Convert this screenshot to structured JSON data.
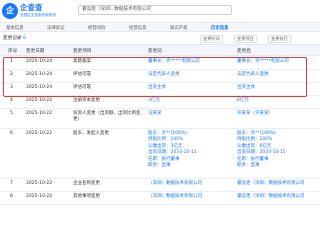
{
  "header": {
    "logo_mark": "企",
    "logo_name": "企查查",
    "logo_sub": "全国企业信用查询系统",
    "company_name": "睿竞炬（深圳）数据技术有限公司"
  },
  "tabs": [
    {
      "label": "基本信息"
    },
    {
      "label": "法律诉讼"
    },
    {
      "label": "经营风险"
    },
    {
      "label": "经营信息"
    },
    {
      "label": "知识产权"
    },
    {
      "label": "历史信息"
    }
  ],
  "toolbar": {
    "title": "变更记录",
    "count": "9",
    "filter_time": "变更时间",
    "filter_item": "变更项目",
    "filter_more": "变更前后"
  },
  "table": {
    "columns": [
      "序号",
      "变更日期",
      "变更项目",
      "变更前",
      "变更后"
    ],
    "rows": [
      {
        "idx": "1",
        "date": "2025-10-24",
        "item": "高管备案",
        "before": [
          "董事长：许*****有限公司"
        ],
        "after": [
          "董事长：许*****有限公司"
        ]
      },
      {
        "idx": "2",
        "date": "2025-10-24",
        "item": "评估可靠",
        "before": [
          "法定代表人变更"
        ],
        "after": [
          "法定代表人变更"
        ]
      },
      {
        "idx": "3",
        "date": "2025-10-24",
        "item": "评估可靠",
        "before": [
          "出资主体"
        ],
        "after": [
          "出资主体"
        ]
      },
      {
        "idx": "4",
        "date": "2025-10-22",
        "item": "注册资本变更",
        "before": [
          "3亿元"
        ],
        "after": [
          "6亿元"
        ]
      },
      {
        "idx": "5",
        "date": "2025-10-22",
        "item": "投资人变更（出资额、出资比例变更）",
        "before": [
          "马某某"
        ],
        "after": [
          "许某某（许某某）"
        ]
      },
      {
        "idx": "6",
        "date": "2025-10-22",
        "item": "股东、发起人变更",
        "before": [
          "股东：许**(100%)",
          "持股比例：100%",
          "认缴出资：3亿元",
          "出资日期：2033-10-15",
          "任职：执行董事",
          "职务：监事"
        ],
        "after": [
          "股东：许**(100%)",
          "持股比例：100%",
          "认缴出资：6亿元",
          "出资日期：2033-10-15",
          "任职：执行董事",
          "职务：监事"
        ]
      },
      {
        "idx": "7",
        "date": "2025-10-22",
        "item": "企业名称变更",
        "before": [
          "（深圳）数据技术有限公司"
        ],
        "after": [
          "睿竞炬（深圳）数据技术有限公司"
        ]
      },
      {
        "idx": "8",
        "date": "2025-10-22",
        "item": "其他事项变更",
        "before": [
          "（深圳）数据技术有限公司"
        ],
        "after": [
          "睿竞炬（深圳）数据技术有限公司"
        ]
      }
    ]
  },
  "colors": {
    "accent": "#1677ff",
    "highlight": "#e53935"
  }
}
